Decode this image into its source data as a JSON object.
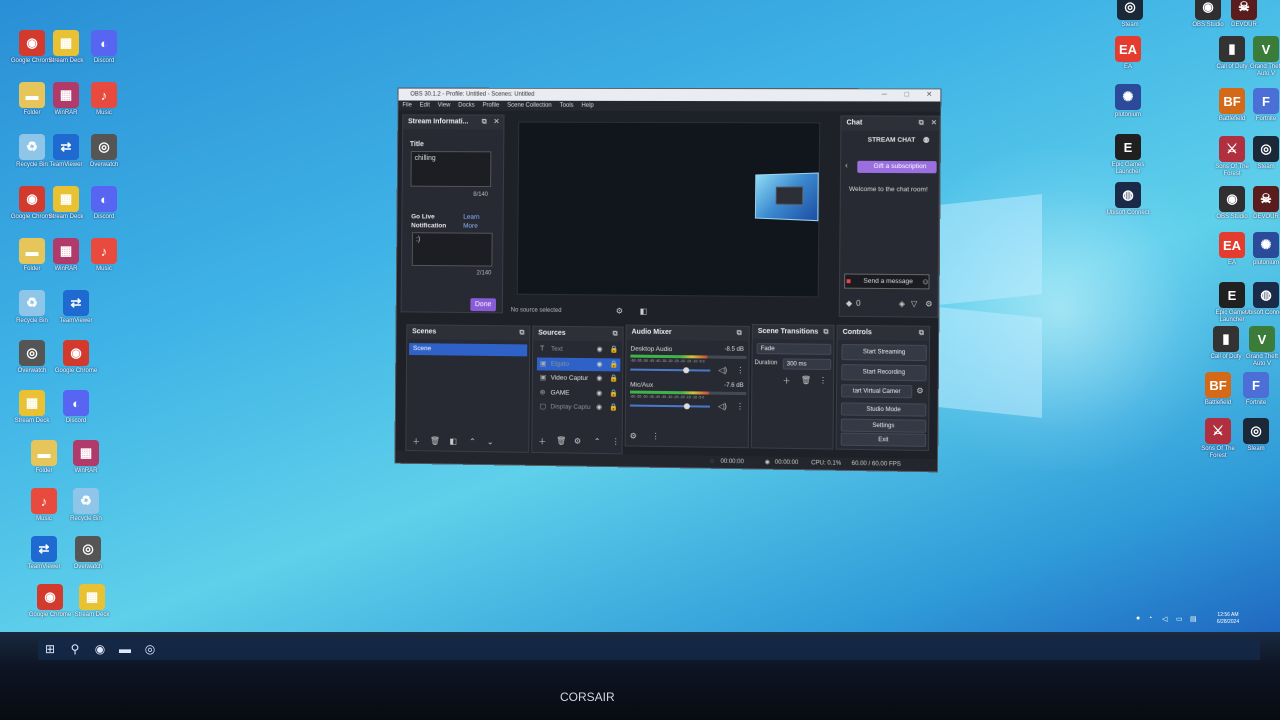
{
  "desktop": {
    "left_icons": [
      {
        "label": "Google Chrome",
        "glyph": "◉",
        "color": "#d23a2e"
      },
      {
        "label": "Stream Deck",
        "glyph": "▦",
        "color": "#e8c232"
      },
      {
        "label": "Discord",
        "glyph": "◐",
        "color": "#5865f2"
      },
      {
        "label": "Folder",
        "glyph": "▬",
        "color": "#e6c55b"
      },
      {
        "label": "WinRAR",
        "glyph": "▦",
        "color": "#b03b6a"
      },
      {
        "label": "Music",
        "glyph": "♪",
        "color": "#e84a3e"
      },
      {
        "label": "Recycle Bin",
        "glyph": "♻",
        "color": "#8ec5e8"
      },
      {
        "label": "TeamViewer",
        "glyph": "⇄",
        "color": "#1f6ad1"
      },
      {
        "label": "Overwatch",
        "glyph": "◎",
        "color": "#555555"
      }
    ],
    "right_icons": [
      {
        "label": "Steam",
        "glyph": "◎",
        "color": "#1b2838"
      },
      {
        "label": "OBS Studio",
        "glyph": "◉",
        "color": "#302e31"
      },
      {
        "label": "DEVOUR",
        "glyph": "☠",
        "color": "#5a1c1c"
      },
      {
        "label": "EA",
        "glyph": "EA",
        "color": "#e43d30"
      },
      {
        "label": "plutonium",
        "glyph": "✺",
        "color": "#2b4a9a"
      },
      {
        "label": "Epic Games Launcher",
        "glyph": "E",
        "color": "#202020"
      },
      {
        "label": "Ubisoft Connect",
        "glyph": "◍",
        "color": "#1a2b4a"
      },
      {
        "label": "Call of Duty",
        "glyph": "▮",
        "color": "#333333"
      },
      {
        "label": "Grand Theft Auto V",
        "glyph": "V",
        "color": "#3b7c3b"
      },
      {
        "label": "Battlefield",
        "glyph": "BF",
        "color": "#d46a18"
      },
      {
        "label": "Fortnite",
        "glyph": "F",
        "color": "#4b6fd6"
      },
      {
        "label": "Sons Of The Forest",
        "glyph": "⚔",
        "color": "#b03040"
      }
    ]
  },
  "taskbar": {
    "items": [
      {
        "name": "start",
        "glyph": "⊞"
      },
      {
        "name": "search",
        "glyph": "⚲"
      },
      {
        "name": "chrome",
        "glyph": "◉"
      },
      {
        "name": "explorer",
        "glyph": "▬"
      },
      {
        "name": "obs",
        "glyph": "◎"
      }
    ],
    "clock_time": "12:56 AM",
    "clock_date": "6/28/2024"
  },
  "obs": {
    "window_title": "OBS 30.1.2 - Profile: Untitled - Scenes: Untitled",
    "menu": [
      "File",
      "Edit",
      "View",
      "Docks",
      "Profile",
      "Scene Collection",
      "Tools",
      "Help"
    ],
    "stream_info": {
      "header": "Stream Informati...",
      "title_label": "Title",
      "title_value": "chilling",
      "title_count": "8/140",
      "golive_label_1": "Go Live",
      "golive_label_2": "Notification",
      "learn_more": "Learn More",
      "golive_value": ":)",
      "golive_count": "2/140",
      "done": "Done"
    },
    "preview_status": "No source selected",
    "chat": {
      "header": "Chat",
      "stream_chat": "STREAM CHAT",
      "gift": "Gift a subscription",
      "welcome": "Welcome to the chat room!",
      "send_placeholder": "Send a message",
      "viewer_count": "0"
    },
    "scenes": {
      "header": "Scenes",
      "items": [
        "Scene"
      ]
    },
    "sources": {
      "header": "Sources",
      "items": [
        {
          "name": "Text",
          "icon": "T"
        },
        {
          "name": "Elgato",
          "icon": "▣"
        },
        {
          "name": "Video Captur",
          "icon": "▣"
        },
        {
          "name": "GAME",
          "icon": "⊛"
        },
        {
          "name": "Display Captu",
          "icon": "▢"
        }
      ]
    },
    "mixer": {
      "header": "Audio Mixer",
      "channels": [
        {
          "name": "Desktop Audio",
          "db": "-8.5 dB",
          "level": 0.66
        },
        {
          "name": "Mic/Aux",
          "db": "-7.6 dB",
          "level": 0.68
        }
      ],
      "scale": "-60 -55 -50 -45 -40 -35 -30 -25 -20 -15 -10 -5 0"
    },
    "transitions": {
      "header": "Scene Transitions",
      "selected": "Fade",
      "duration_label": "Duration",
      "duration_value": "300 ms"
    },
    "controls": {
      "header": "Controls",
      "buttons": [
        "Start Streaming",
        "Start Recording",
        "tart Virtual Camer",
        "Studio Mode",
        "Settings",
        "Exit"
      ]
    },
    "status": {
      "rec_time": "00:00:00",
      "stream_time": "00:00:00",
      "cpu": "CPU: 0.1%",
      "fps": "60.00 / 60.00 FPS"
    }
  },
  "bezel_brand": "CORSAIR"
}
